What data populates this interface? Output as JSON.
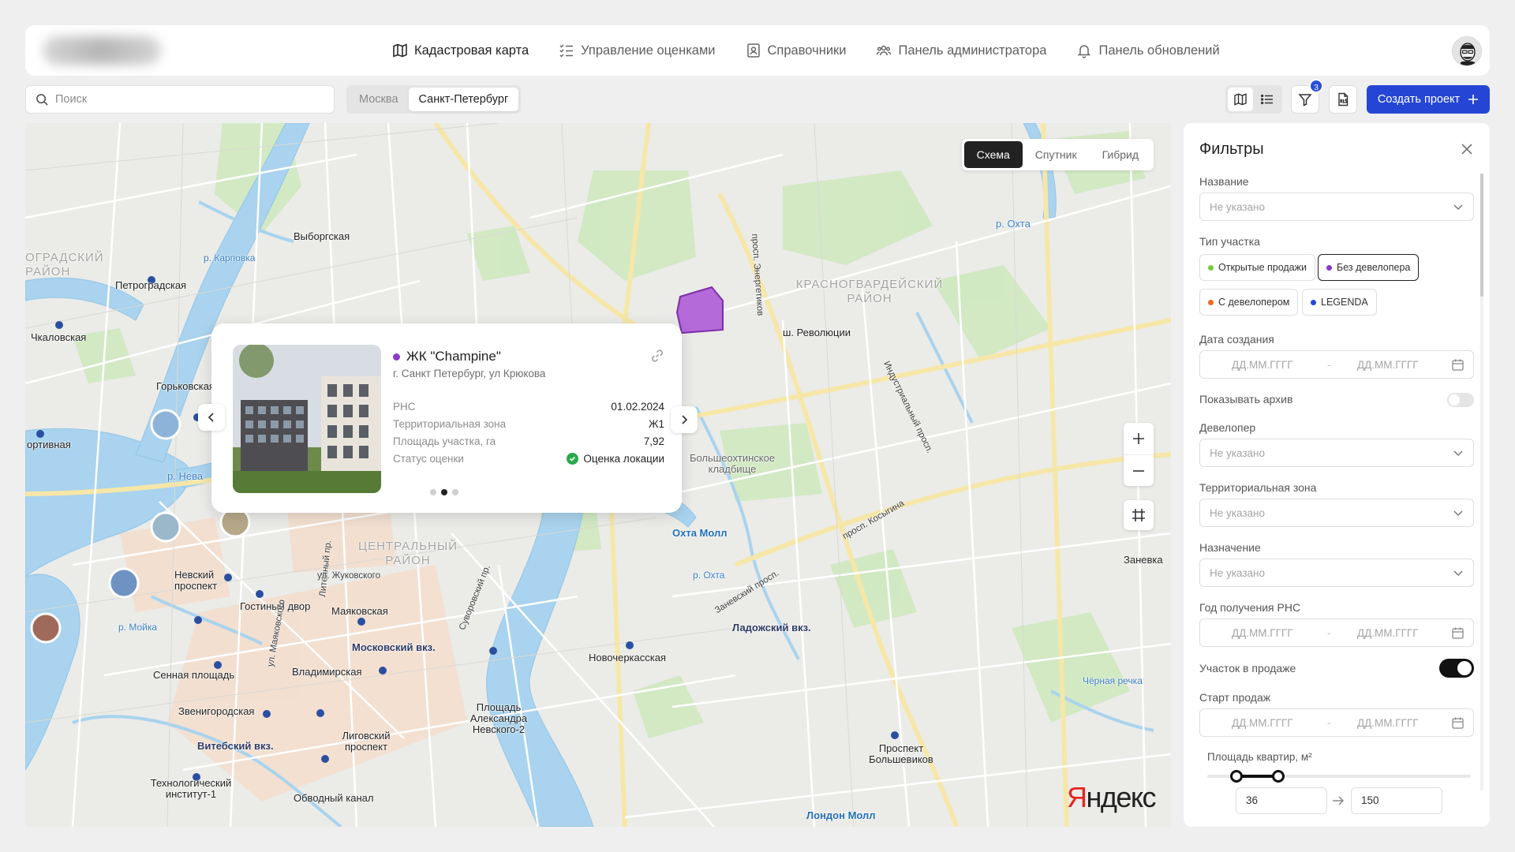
{
  "nav": {
    "items": [
      {
        "label": "Кадастровая карта",
        "icon": "map-icon",
        "active": true
      },
      {
        "label": "Управление оценками",
        "icon": "checklist-icon",
        "active": false
      },
      {
        "label": "Справочники",
        "icon": "contacts-book-icon",
        "active": false
      },
      {
        "label": "Панель администратора",
        "icon": "users-icon",
        "active": false
      },
      {
        "label": "Панель обновлений",
        "icon": "bell-icon",
        "active": false
      }
    ]
  },
  "search": {
    "placeholder": "Поиск"
  },
  "cities": {
    "items": [
      "Москва",
      "Санкт-Петербург"
    ],
    "selected": "Санкт-Петербург"
  },
  "toolbar": {
    "filter_count": "3",
    "create_label": "Создать проект"
  },
  "map": {
    "types": [
      "Схема",
      "Спутник",
      "Гибрид"
    ],
    "selected_type": "Схема",
    "attribution": [
      "Я",
      "ндекс"
    ],
    "labels": {
      "vyborgskaya": "Выборгская",
      "petrogradskaya": "Петроградская",
      "chkalovskaya": "Чкаловская",
      "gorkovskaya": "Горьковская",
      "sportivnaya": "ортивная",
      "nevsky_prospekt": "Невский проспект",
      "gostiny_dvor": "Гостиный двор",
      "mayakovskaya": "Маяковская",
      "moskovsky_vkz": "Московский вкз.",
      "vladimirskaya": "Владимирская",
      "sennaya": "Сенная площадь",
      "zvenigorodskaya": "Звенигородская",
      "vitebsky_vkz": "Витебский вкз.",
      "ligovsky": "Лиговский проспект",
      "ploshchad_nevskogo": "Площадь Александра Невского-2",
      "novocherkasskaya": "Новочеркасская",
      "ladozhsky_vkz": "Ладожский вкз.",
      "okhta_moll": "Охта Молл",
      "prospekt_bolshevikov": "Проспект Большевиков",
      "tekhnologichesky": "Технологический институт-1",
      "obvodny": "Обводный канал",
      "london_moll": "Лондон Молл",
      "zanevka": "Заневка",
      "bolsheokhtinskoe": "Большеохтинское кладбище",
      "revolyutsii": "ш. Революции",
      "district_center": "ЦЕНТРАЛЬНЫЙ РАЙОН",
      "district_krasnogv": "КРАСНОГВАРДЕЙСКИЙ РАЙОН",
      "district_petrograd": "ОГРАДСКИЙ РАЙОН",
      "river_neva": "р. Нева",
      "river_okhta": "р. Охта",
      "river_karpovka": "р. Карповка",
      "river_moika": "р. Мойка",
      "river_okhta2": "р. Охта",
      "chernaya": "Чёрная речка",
      "liteyny": "Литейный пр.",
      "suvorovsky": "Суворовский пр.",
      "zhukovskogo": "ул. Жуковского",
      "kosygina": "просп. Косыгина",
      "zanevsky": "Заневский просп.",
      "industrialny": "Индустриальный просп.",
      "energetikov": "просп. Энергетиков",
      "mayakovskogo": "ул. Маяковского"
    }
  },
  "card": {
    "title": "ЖК \"Champine\"",
    "status_color": "#8b3bc9",
    "address": "г. Санкт Петербург, ул Крюкова",
    "rows": [
      {
        "key": "РНС",
        "value": "01.02.2024"
      },
      {
        "key": "Территориальная зона",
        "value": "Ж1"
      },
      {
        "key": "Площадь участка, га",
        "value": "7,92"
      },
      {
        "key": "Статус оценки",
        "value": "Оценка локации",
        "check": true
      }
    ],
    "slide_index": 2,
    "slide_count": 3
  },
  "filters": {
    "title": "Фильтры",
    "name_label": "Название",
    "name_placeholder": "Не указано",
    "plot_type_label": "Тип участка",
    "chips": [
      {
        "label": "Открытые продажи",
        "color": "#7ac943",
        "active": false
      },
      {
        "label": "Без девелопера",
        "color": "#8b3bc9",
        "active": true
      },
      {
        "label": "С девелопером",
        "color": "#f26a21",
        "active": false
      },
      {
        "label": "LEGENDA",
        "color": "#2546d5",
        "active": false
      }
    ],
    "created_label": "Дата создания",
    "date_placeholder": "ДД.ММ.ГГГГ",
    "archive_label": "Показывать архив",
    "archive_on": false,
    "developer_label": "Девелопер",
    "developer_placeholder": "Не указано",
    "zone_label": "Территориальная зона",
    "zone_placeholder": "Не указано",
    "purpose_label": "Назначение",
    "purpose_placeholder": "Не указано",
    "rns_year_label": "Год получения РНС",
    "on_sale_label": "Участок в продаже",
    "on_sale_on": true,
    "sales_start_label": "Старт продаж",
    "area_label": "Площадь квартир, м²",
    "area_min": "36",
    "area_max": "150",
    "area_knob_low": 0.11,
    "area_knob_high": 0.27
  }
}
